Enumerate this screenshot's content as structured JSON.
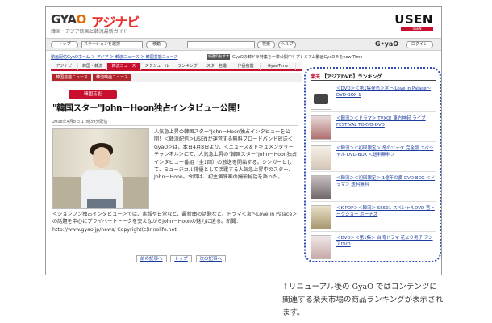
{
  "header": {
    "logo_gyao_a": "GYA",
    "logo_gyao_b": "O",
    "logo_asia": "アジナビ",
    "tagline": "韓国・アジア映画と韓流最新ガイド",
    "logo_usen": "USEN",
    "logo_usen_sub": "USEN CORPORATION"
  },
  "toolbar": {
    "btn_top": "トップ",
    "select_value": "ステーションを選択",
    "btn_go": "移動",
    "btn_search": "検索",
    "btn_help": "ヘルプ",
    "gyao_label": "G•yaO",
    "btn_mypage": "ログイン"
  },
  "breadcrumb": "動画配信GyaOホーム ＞ アジア ＞ 韓流ニュース ＞ 韓国芸能ニュース",
  "promo": {
    "label": "今週のおすすめ",
    "text": "GyaOの韓ドラ特集を一挙公開中！プレミアム動画GyaO®をnow Time"
  },
  "nav": {
    "tabs": [
      "アジナビ",
      "韓国・韓流",
      "韓流ニュース",
      "スケジュール",
      "ランキング",
      "スター名鑑",
      "作品名鑑",
      "GyaoTime"
    ],
    "active_index": 2,
    "sub_tabs": [
      "韓国芸能ニュース",
      "韓流映画ニュース"
    ]
  },
  "article": {
    "category": "韓国芸能",
    "headline": "\"韓国スター\"John－Hoon独占インタビュー公開！",
    "dateline": "2008年4月8日 17時39分配信",
    "share": "印刷｜拡大",
    "paragraph_side": "人気急上昇の韓国スター\"John－Hoon独占インタビューを公開！＜韓流配信＞USENが運営する無料ブロードバンド放送＜GyaO＞は、本日4月8日より、＜ニュース＆ドキュメンタリーチャンネル＞にて、人気急上昇の\"韓国スター\"John－Hoon独占インタビュー番組（全1回）の放送を開始する。シンガーとして、ミュージカル俳優として活躍する人気急上昇中のスター、John－Hoon。今回は、初主演映画の撮影秘話を語った。",
    "paragraph_full": "＜ジョンフン独占インタビュー＞では、素顔や日常など、最新曲の話題など、ドラマ＜宮～Love in Palace＞の話題を中心にプライベートトークを交えながらJohn－Hoonの魅力に迫る。新聞：http://www.gyao.jp/news/ Copyright(c)Innolife.net",
    "bottom_links": [
      "前の記事へ",
      "トップ",
      "次の記事へ"
    ]
  },
  "ranking": {
    "title_mark": "楽天",
    "title": "【アジアDVD】ランキング",
    "items": [
      {
        "title": "＜DVD＞＜第1集発売＞宮 ～Love in Palace～ DVD-BOX 1"
      },
      {
        "title": "＜韓流＞＜ドラマ＞ TVXQ! 東方神起 ライブ FESTIVAL TOKYO-DVD"
      },
      {
        "title": "＜韓流＞＜初回限定＞ 冬のソナタ 完全版 スペシャル DVD-BOX ＜送料無料＞"
      },
      {
        "title": "＜韓流＞＜初回限定＞ 1億年の愛 DVD-BOX ＜ドラマ＞ 送料無料"
      },
      {
        "title": "＜K-POP＞＜韓流＞ SS501 スペシャルDVD 宮トークショー ボーナス"
      },
      {
        "title": "＜DVD＞＜第1集＞ 台湾ドラマ 花より男子 アジアDVD"
      }
    ]
  },
  "caption": "↑リニューアル後の GyaO ではコンテンツに関連する楽天市場の商品ランキングが表示されます。"
}
